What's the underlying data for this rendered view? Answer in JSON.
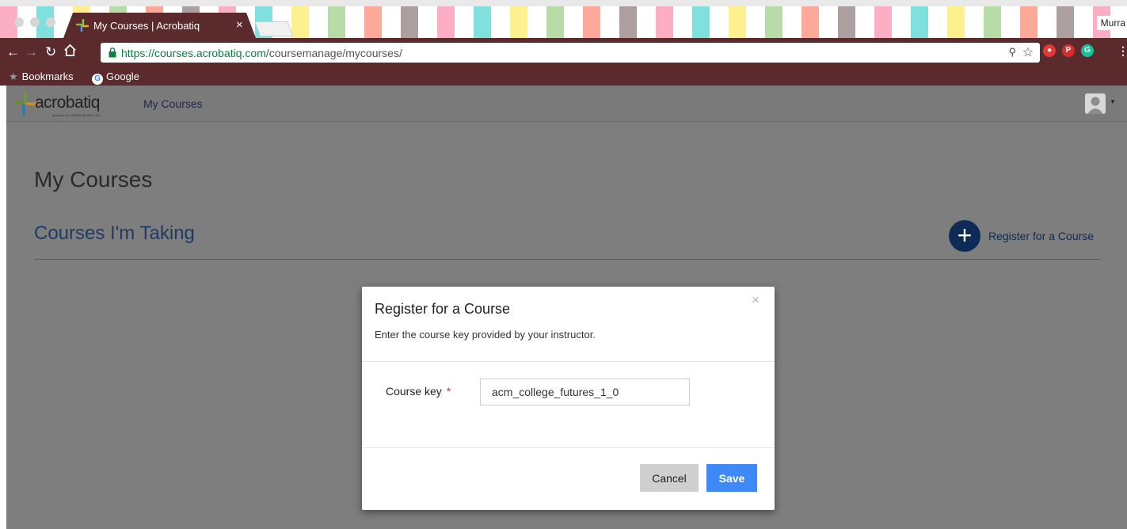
{
  "browser": {
    "tab_title": "My Courses | Acrobatiq",
    "tab_close": "×",
    "profile_name": "Murra",
    "url_secure": "https://courses.acrobatiq.com",
    "url_path": "/coursemanage/mycourses/",
    "bookmarks": [
      "Bookmarks",
      "Google"
    ],
    "icons": {
      "back": "arrow-left-icon",
      "forward": "arrow-right-icon",
      "reload": "reload-icon",
      "home": "home-icon",
      "lock": "lock-icon",
      "star": "star-icon"
    },
    "colors": {
      "chrome": "#5a2a2c",
      "secure": "#0b8043"
    }
  },
  "app": {
    "logo": "acrobatiq",
    "logo_sub": "powered by CARNEGIE MELLON",
    "nav_my_courses": "My Courses"
  },
  "page": {
    "title": "My Courses",
    "section_title": "Courses I'm Taking",
    "register_button_label": "Register for a Course",
    "register_plus": "+"
  },
  "modal": {
    "title": "Register for a Course",
    "description": "Enter the course key provided by your instructor.",
    "close": "×",
    "field_label": "Course key",
    "required_mark": "*",
    "field_value": "acm_college_futures_1_0",
    "cancel_label": "Cancel",
    "save_label": "Save",
    "colors": {
      "save": "#3d8af7",
      "cancel": "#cfcfcf",
      "required": "#d9302c"
    }
  }
}
